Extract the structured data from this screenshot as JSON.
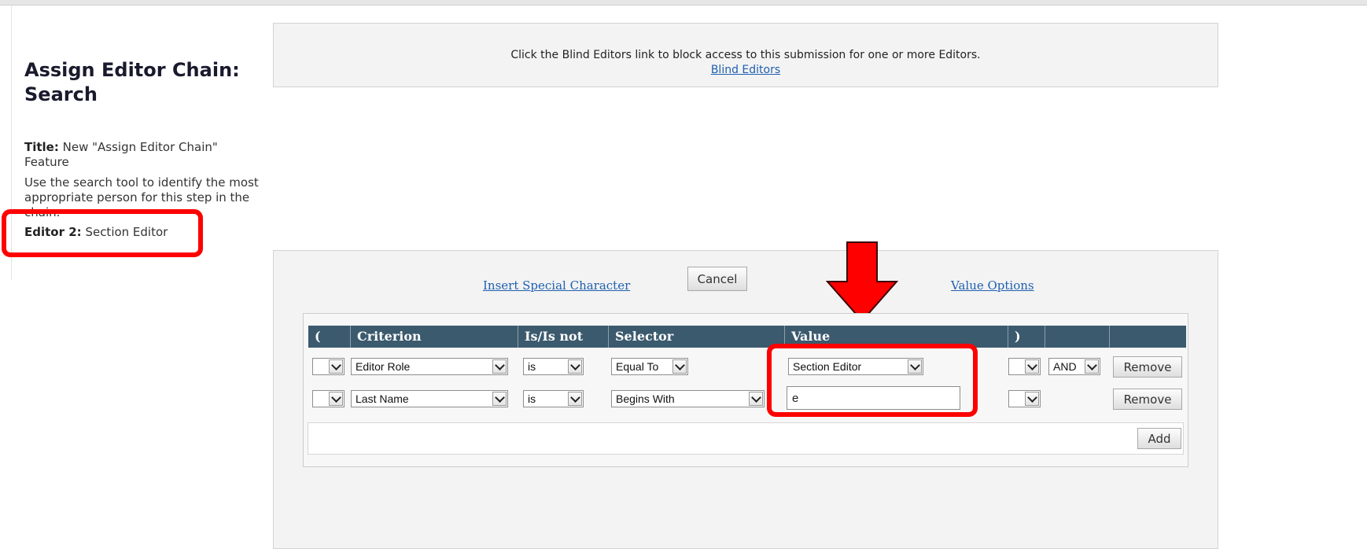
{
  "sidebar": {
    "heading": "Assign Editor Chain: Search",
    "title_label": "Title:",
    "title_value": "New \"Assign Editor Chain\" Feature",
    "instructions": "Use the search tool to identify the most appropriate person for this step in the chain.",
    "editor_label": "Editor 2:",
    "editor_value": "Section Editor"
  },
  "blind_notice": {
    "message": "Click the Blind Editors link to block access to this submission for one or more Editors.",
    "link": "Blind Editors"
  },
  "search_panel": {
    "insert_special_character": "Insert Special Character",
    "cancel": "Cancel",
    "value_options": "Value Options",
    "columns": [
      "(",
      "Criterion",
      "Is/Is not",
      "Selector",
      "Value",
      ")",
      "",
      ""
    ],
    "rows": [
      {
        "open_paren": "",
        "criterion": "Editor Role",
        "is_not": "is",
        "selector": "Equal To",
        "value": "Section Editor",
        "close_paren": "",
        "conjunction": "AND",
        "remove": "Remove"
      },
      {
        "open_paren": "",
        "criterion": "Last Name",
        "is_not": "is",
        "selector": "Begins With",
        "value": "e",
        "close_paren": "",
        "conjunction": "",
        "remove": "Remove"
      }
    ],
    "add": "Add"
  },
  "annotations": {
    "highlight_color": "#ff0000",
    "arrow": "down-arrow-icon"
  }
}
